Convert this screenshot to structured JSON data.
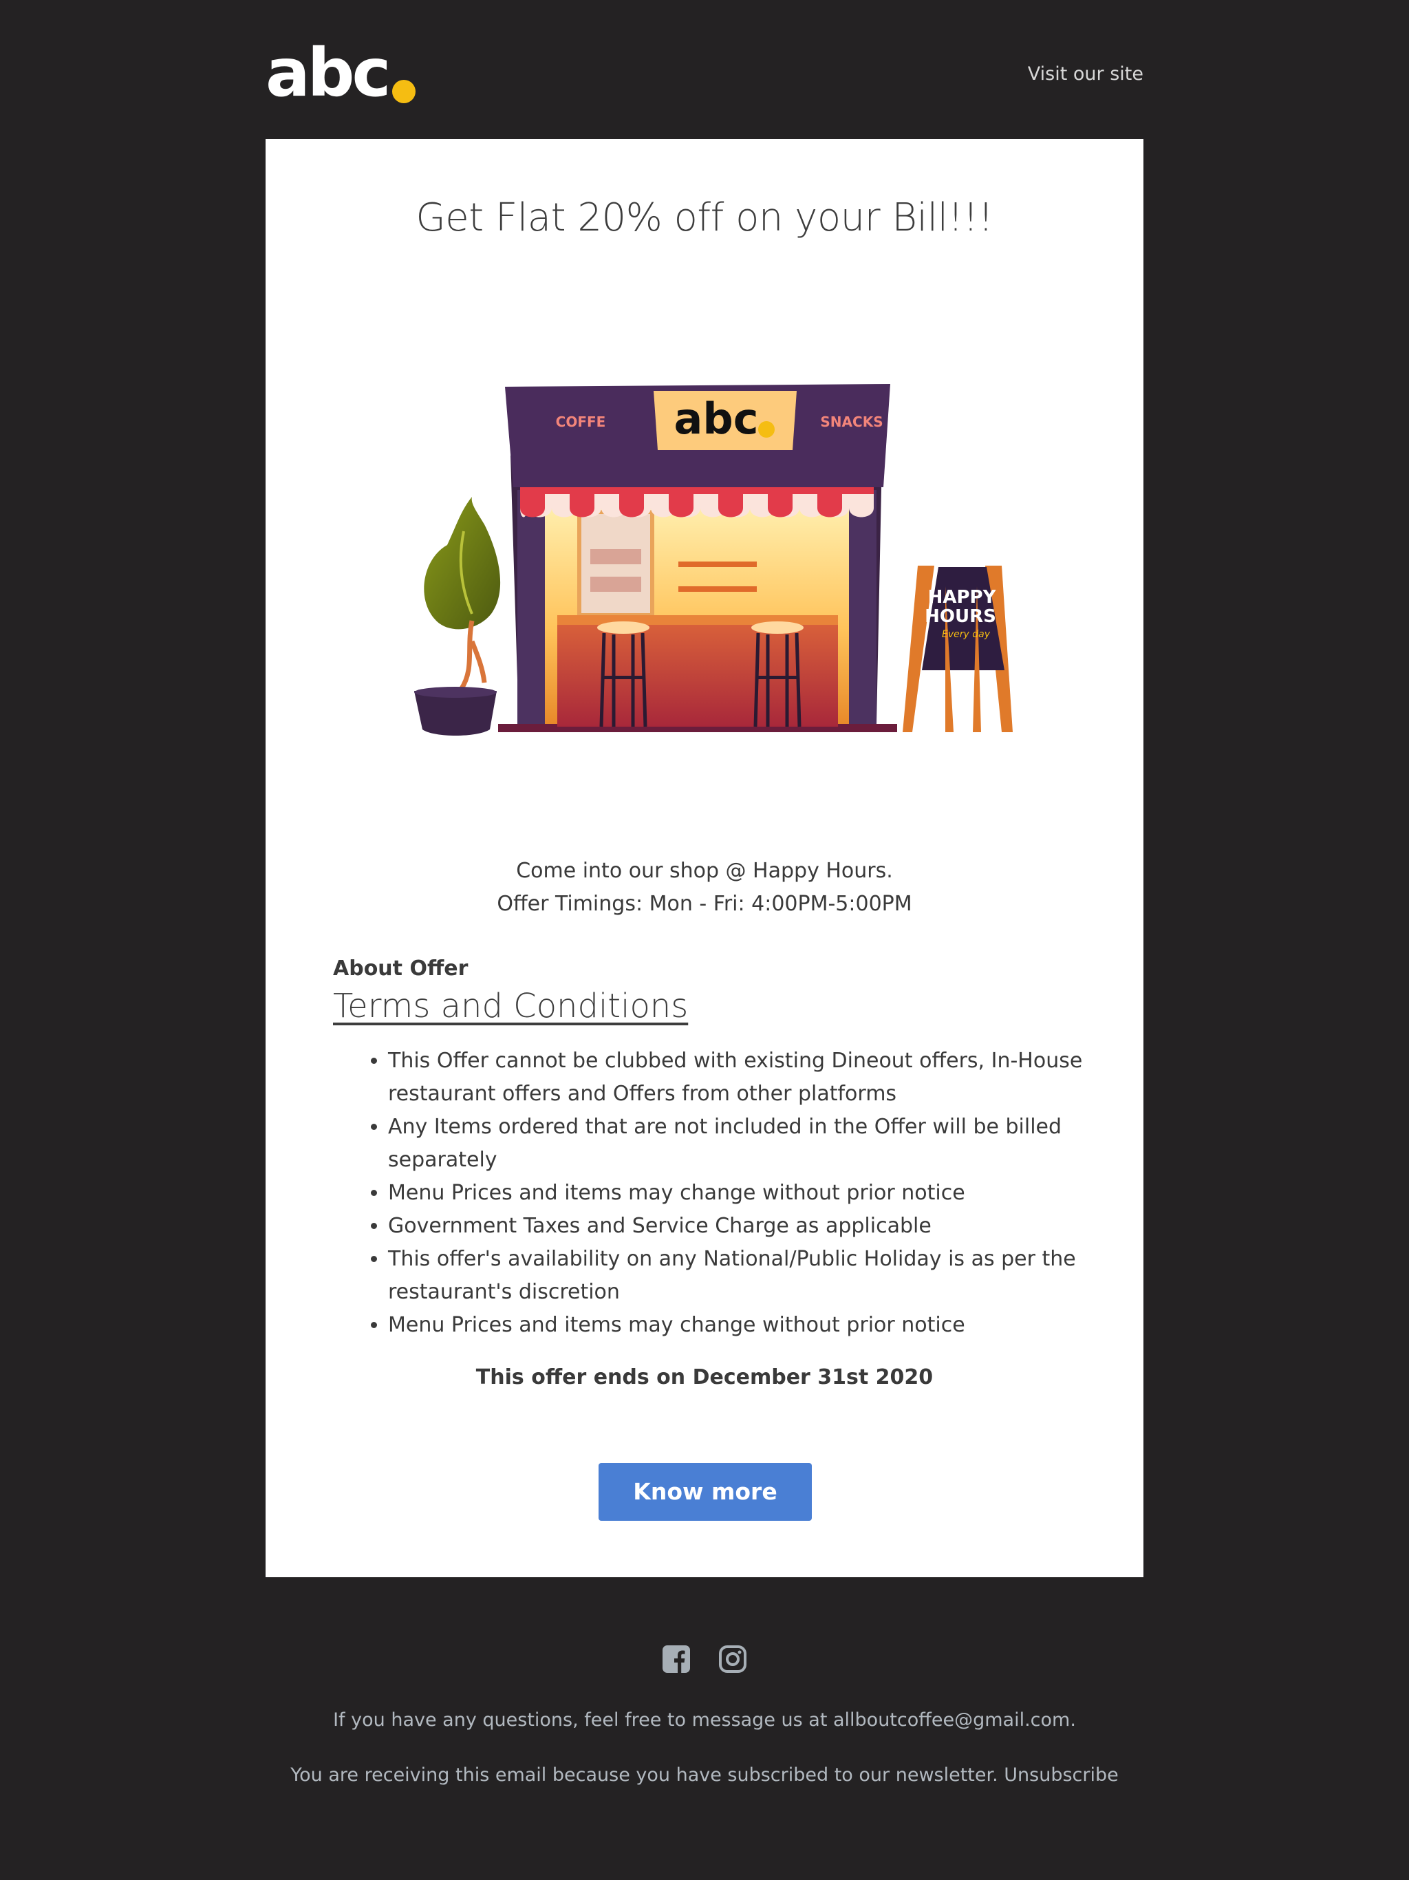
{
  "header": {
    "logo_text": "abc",
    "visit_link": "Visit our site"
  },
  "card": {
    "headline": "Get Flat 20% off on your Bill!!!",
    "illustration": {
      "sign_left": "COFFE",
      "sign_center": "abc",
      "sign_right": "SNACKS",
      "board_line1": "HAPPY",
      "board_line2": "HOURS",
      "board_line3": "Every day"
    },
    "intro_line1": "Come into our shop @ Happy Hours.",
    "intro_line2": "Offer Timings: Mon - Fri: 4:00PM-5:00PM",
    "about_label": "About Offer",
    "terms_title": "Terms and Conditions",
    "terms": [
      "This Offer cannot be clubbed with existing Dineout offers, In-House restaurant offers and Offers from other platforms",
      "Any Items ordered that are not included in the Offer will be billed separately",
      "Menu Prices and items may change without prior notice",
      "Government Taxes and Service Charge as applicable",
      "This offer's availability on any National/Public Holiday is as per the restaurant's discretion",
      "Menu Prices and items may change without prior notice"
    ],
    "ends_text": "This offer ends on December 31st 2020",
    "cta_label": "Know more"
  },
  "footer": {
    "social_icons": [
      "facebook-icon",
      "instagram-icon"
    ],
    "questions_text": "If you have any questions, feel free to message us at allboutcoffee@gmail.com.",
    "subscription_text": "You are receiving this email because you have subscribed to our newsletter.",
    "unsubscribe_label": "Unsubscribe"
  },
  "colors": {
    "background": "#242223",
    "card": "#ffffff",
    "accent_dot": "#f5bd12",
    "button": "#4a7fd4",
    "footer_text": "#b2b9c0"
  }
}
